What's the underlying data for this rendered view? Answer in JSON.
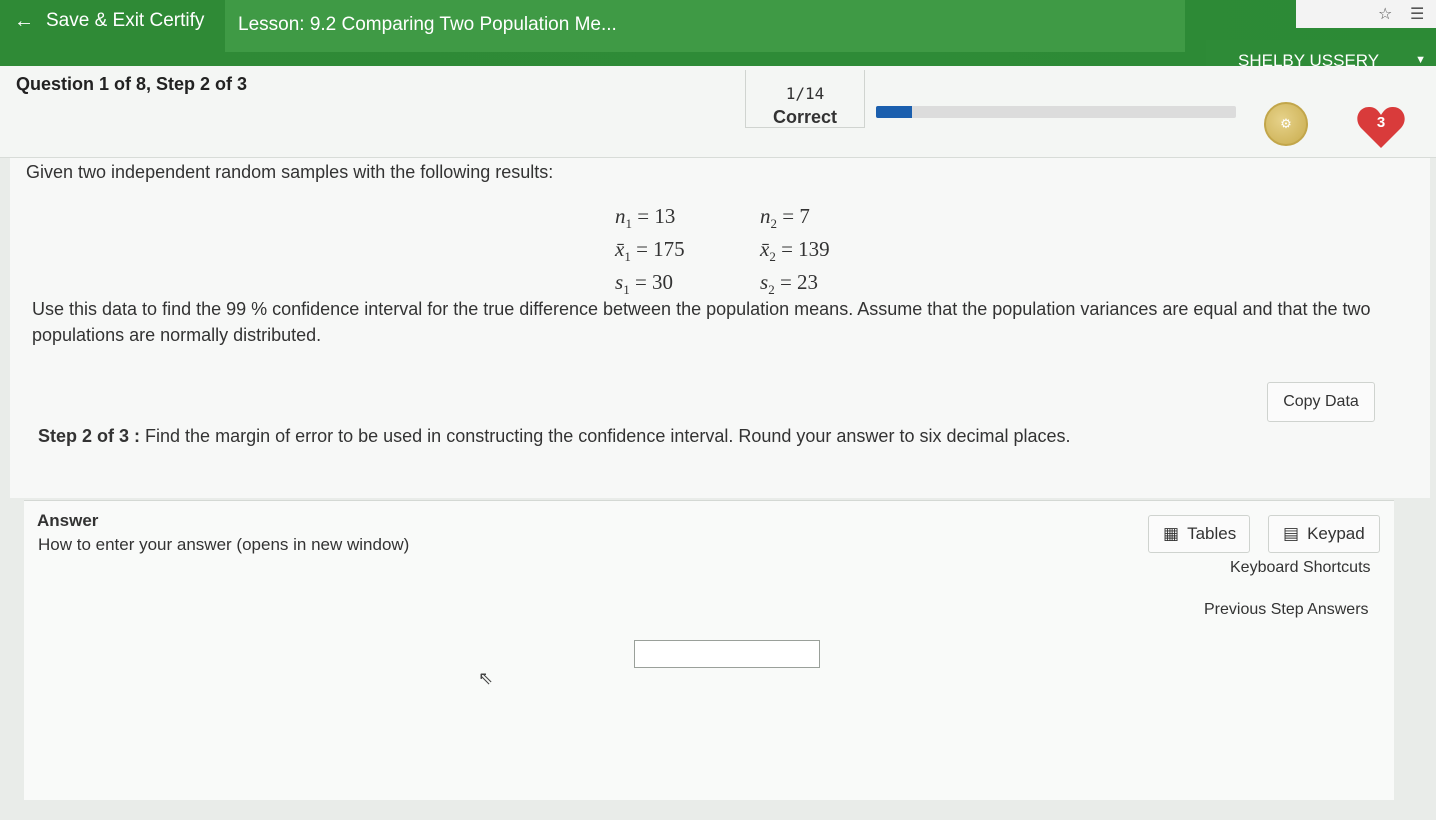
{
  "header": {
    "save_exit": "Save & Exit Certify",
    "lesson": "Lesson: 9.2 Comparing Two Population Me...",
    "user": "SHELBY USSERY"
  },
  "status": {
    "question_step": "Question 1 of 8, Step 2 of 3",
    "count": "1/14",
    "state": "Correct",
    "progress_fraction": 0.1,
    "heart_count": "3",
    "progress_color": "#1b5fae",
    "heart_color": "#d93b3b"
  },
  "problem": {
    "intro": "Given two independent random samples with the following results:",
    "stats": [
      {
        "left_sym": "n",
        "left_sub": "1",
        "left_val": "= 13",
        "right_sym": "n",
        "right_sub": "2",
        "right_val": "= 7"
      },
      {
        "left_sym": "x̄",
        "left_sub": "1",
        "left_val": "= 175",
        "right_sym": "x̄",
        "right_sub": "2",
        "right_val": "= 139"
      },
      {
        "left_sym": "s",
        "left_sub": "1",
        "left_val": "= 30",
        "right_sym": "s",
        "right_sub": "2",
        "right_val": "= 23"
      }
    ],
    "instructions": "Use this data to find the 99 % confidence interval for the true difference between the population means. Assume that the population variances are equal and that the two populations are normally distributed.",
    "copy_data": "Copy Data",
    "step_label": "Step 2 of 3 :",
    "step_text": "Find the margin of error to be used in constructing the confidence interval. Round your answer to six decimal places."
  },
  "answer": {
    "title": "Answer",
    "howto": "How to enter your answer (opens in new window)",
    "tables": "Tables",
    "keypad": "Keypad",
    "keyboard_shortcuts": "Keyboard Shortcuts",
    "previous_step_answers": "Previous Step Answers",
    "input_value": ""
  },
  "icons": [
    "back-arrow-icon",
    "star-icon",
    "favorites-icon",
    "coin-icon",
    "heart-icon",
    "table-icon",
    "calculator-icon",
    "mouse-cursor-icon"
  ]
}
